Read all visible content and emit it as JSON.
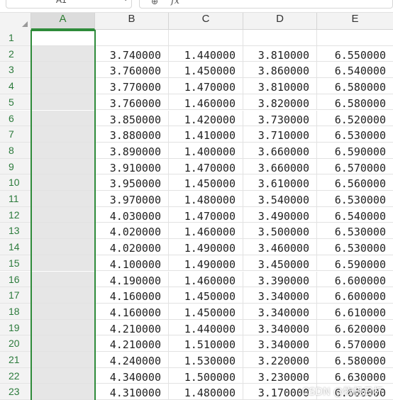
{
  "name_box": {
    "value": "A1"
  },
  "formula_bar": {
    "fx_label": "fx",
    "zoom_icon": "zoom-icon"
  },
  "columns": [
    "A",
    "B",
    "C",
    "D",
    "E"
  ],
  "rows": [
    {
      "num": "1",
      "b": "",
      "c": "",
      "d": "",
      "e": ""
    },
    {
      "num": "2",
      "b": "3.740000",
      "c": "1.440000",
      "d": "3.810000",
      "e": "6.550000"
    },
    {
      "num": "3",
      "b": "3.760000",
      "c": "1.450000",
      "d": "3.860000",
      "e": "6.540000"
    },
    {
      "num": "4",
      "b": "3.770000",
      "c": "1.470000",
      "d": "3.810000",
      "e": "6.580000"
    },
    {
      "num": "5",
      "b": "3.760000",
      "c": "1.460000",
      "d": "3.820000",
      "e": "6.580000"
    },
    {
      "num": "6",
      "b": "3.850000",
      "c": "1.420000",
      "d": "3.730000",
      "e": "6.520000"
    },
    {
      "num": "7",
      "b": "3.880000",
      "c": "1.410000",
      "d": "3.710000",
      "e": "6.530000"
    },
    {
      "num": "8",
      "b": "3.890000",
      "c": "1.400000",
      "d": "3.660000",
      "e": "6.590000"
    },
    {
      "num": "9",
      "b": "3.910000",
      "c": "1.470000",
      "d": "3.660000",
      "e": "6.570000"
    },
    {
      "num": "10",
      "b": "3.950000",
      "c": "1.450000",
      "d": "3.610000",
      "e": "6.560000"
    },
    {
      "num": "11",
      "b": "3.970000",
      "c": "1.480000",
      "d": "3.540000",
      "e": "6.530000"
    },
    {
      "num": "12",
      "b": "4.030000",
      "c": "1.470000",
      "d": "3.490000",
      "e": "6.540000"
    },
    {
      "num": "13",
      "b": "4.020000",
      "c": "1.460000",
      "d": "3.500000",
      "e": "6.530000"
    },
    {
      "num": "14",
      "b": "4.020000",
      "c": "1.490000",
      "d": "3.460000",
      "e": "6.530000"
    },
    {
      "num": "15",
      "b": "4.100000",
      "c": "1.490000",
      "d": "3.450000",
      "e": "6.590000"
    },
    {
      "num": "16",
      "b": "4.190000",
      "c": "1.460000",
      "d": "3.390000",
      "e": "6.600000"
    },
    {
      "num": "17",
      "b": "4.160000",
      "c": "1.450000",
      "d": "3.340000",
      "e": "6.600000"
    },
    {
      "num": "18",
      "b": "4.160000",
      "c": "1.450000",
      "d": "3.340000",
      "e": "6.610000"
    },
    {
      "num": "19",
      "b": "4.210000",
      "c": "1.440000",
      "d": "3.340000",
      "e": "6.620000"
    },
    {
      "num": "20",
      "b": "4.210000",
      "c": "1.510000",
      "d": "3.340000",
      "e": "6.570000"
    },
    {
      "num": "21",
      "b": "4.240000",
      "c": "1.530000",
      "d": "3.220000",
      "e": "6.580000"
    },
    {
      "num": "22",
      "b": "4.340000",
      "c": "1.500000",
      "d": "3.230000",
      "e": "6.630000"
    },
    {
      "num": "23",
      "b": "4.310000",
      "c": "1.480000",
      "d": "3.170000",
      "e": "6.600000"
    }
  ],
  "watermark": "CSDN @物极日杯",
  "colors": {
    "selection": "#2e8b3a",
    "row_number": "#2b7a3b",
    "header_bg": "#f3f3f3"
  }
}
